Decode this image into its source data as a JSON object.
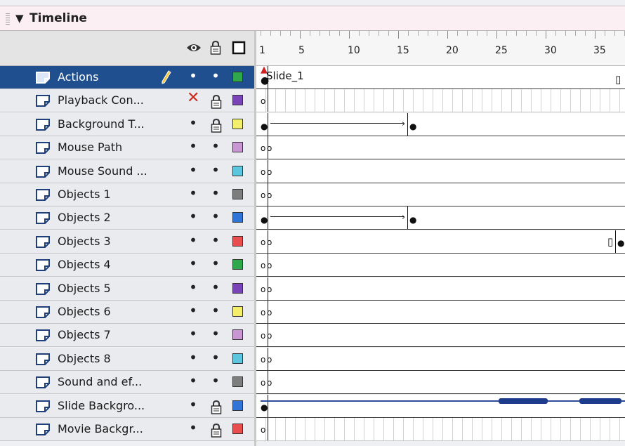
{
  "panel": {
    "title": "Timeline",
    "collapse_icon": "triangle-down"
  },
  "header_icons": {
    "eye": "eye-icon",
    "lock": "lock-icon",
    "outline": "outline-icon"
  },
  "ruler": {
    "labels": [
      "1",
      "5",
      "10",
      "15",
      "20",
      "25",
      "30",
      "35"
    ]
  },
  "layers": [
    {
      "name": "Actions",
      "visible": "•",
      "locked": "•",
      "color": "#2ea84a",
      "selected": true,
      "frames_text": "Slide_1"
    },
    {
      "name": "Playback Con...",
      "visible": "✕",
      "locked": "lock",
      "color": "#7a44b8",
      "selected": false
    },
    {
      "name": "Background T...",
      "visible": "•",
      "locked": "lock",
      "color": "#f4ef6a",
      "selected": false
    },
    {
      "name": "Mouse Path",
      "visible": "•",
      "locked": "•",
      "color": "#c996d4",
      "selected": false
    },
    {
      "name": "Mouse Sound ...",
      "visible": "•",
      "locked": "•",
      "color": "#5cc6de",
      "selected": false
    },
    {
      "name": "Objects 1",
      "visible": "•",
      "locked": "•",
      "color": "#7d7d7d",
      "selected": false
    },
    {
      "name": "Objects 2",
      "visible": "•",
      "locked": "•",
      "color": "#2f74d6",
      "selected": false
    },
    {
      "name": "Objects 3",
      "visible": "•",
      "locked": "•",
      "color": "#e94d4d",
      "selected": false
    },
    {
      "name": "Objects 4",
      "visible": "•",
      "locked": "•",
      "color": "#2ea84a",
      "selected": false
    },
    {
      "name": "Objects 5",
      "visible": "•",
      "locked": "•",
      "color": "#7a44b8",
      "selected": false
    },
    {
      "name": "Objects 6",
      "visible": "•",
      "locked": "•",
      "color": "#f4ef6a",
      "selected": false
    },
    {
      "name": "Objects 7",
      "visible": "•",
      "locked": "•",
      "color": "#c996d4",
      "selected": false
    },
    {
      "name": "Objects 8",
      "visible": "•",
      "locked": "•",
      "color": "#5cc6de",
      "selected": false
    },
    {
      "name": "Sound and ef...",
      "visible": "•",
      "locked": "•",
      "color": "#7d7d7d",
      "selected": false
    },
    {
      "name": "Slide Backgro...",
      "visible": "•",
      "locked": "lock",
      "color": "#2f74d6",
      "selected": false
    },
    {
      "name": "Movie Backgr...",
      "visible": "•",
      "locked": "lock",
      "color": "#e94d4d",
      "selected": false
    }
  ]
}
